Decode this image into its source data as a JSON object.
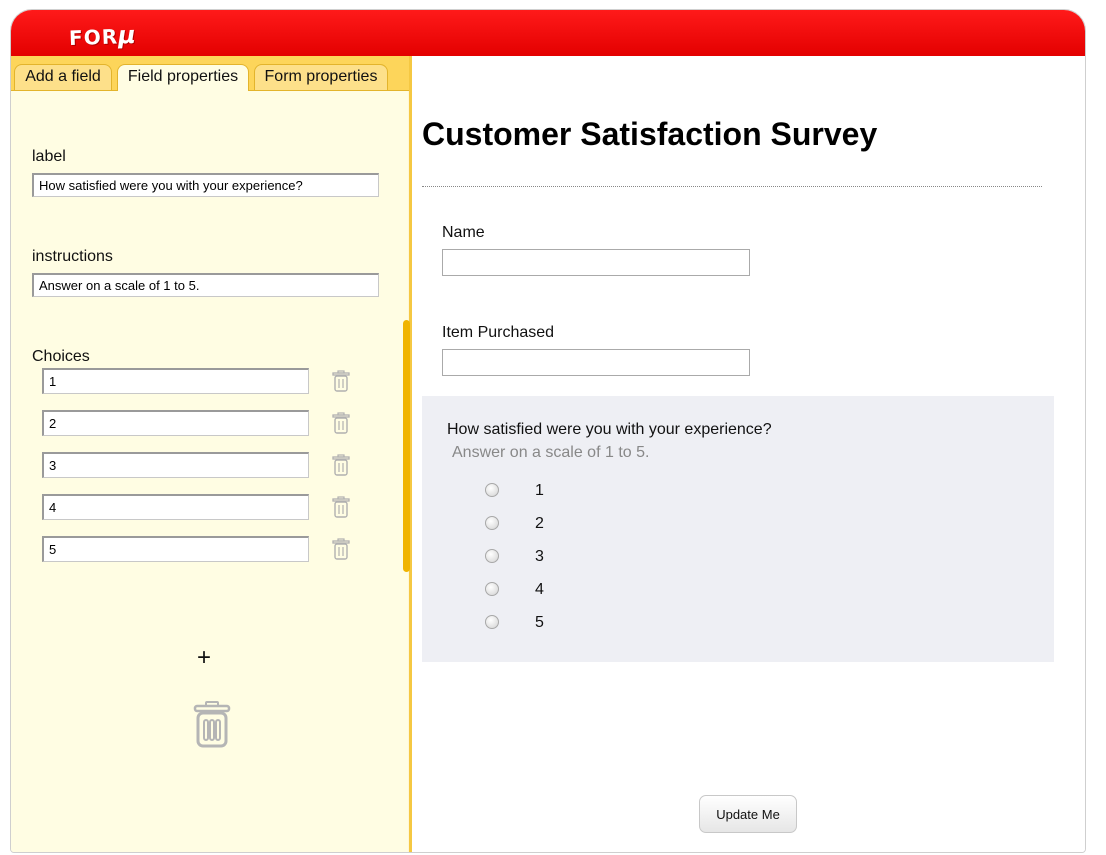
{
  "app": {
    "logo_text": "FOR",
    "logo_mu": "μ"
  },
  "tabs": [
    {
      "label": "Add a field"
    },
    {
      "label": "Field properties"
    },
    {
      "label": "Form properties"
    }
  ],
  "properties": {
    "label_title": "label",
    "label_value": "How satisfied were you with your experience?",
    "instructions_title": "instructions",
    "instructions_value": "Answer on a scale of 1 to 5.",
    "choices_title": "Choices",
    "choices": [
      "1",
      "2",
      "3",
      "4",
      "5"
    ],
    "add_choice_label": "+"
  },
  "form": {
    "title": "Customer Satisfaction Survey",
    "fields": [
      {
        "label": "Name",
        "value": ""
      },
      {
        "label": "Item Purchased",
        "value": ""
      }
    ],
    "question": {
      "label": "How satisfied were you with your experience?",
      "instructions": "Answer on a scale of 1 to 5.",
      "options": [
        "1",
        "2",
        "3",
        "4",
        "5"
      ]
    },
    "submit_label": "Update Me"
  },
  "colors": {
    "header": "#e80000",
    "panel": "#fffde3",
    "tabs": "#fdd55a",
    "question_bg": "#eeeff4"
  }
}
